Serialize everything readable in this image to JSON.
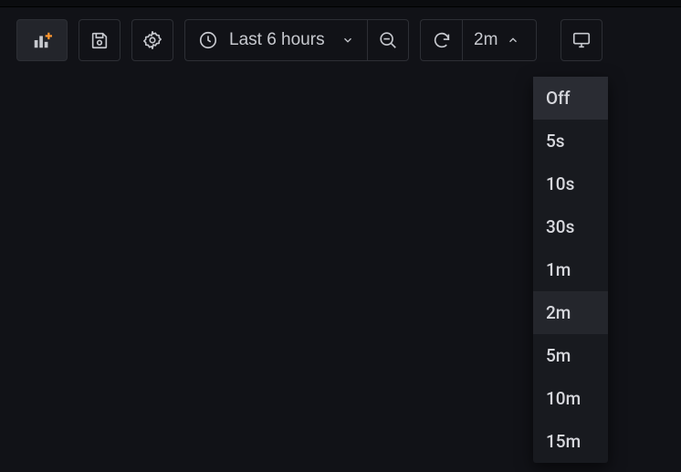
{
  "toolbar": {
    "time_range_label": "Last 6 hours",
    "refresh_interval_label": "2m"
  },
  "refresh_dropdown": {
    "visible": true,
    "highlighted_index": 0,
    "selected_index": 4,
    "options": [
      {
        "label": "Off"
      },
      {
        "label": "5s"
      },
      {
        "label": "10s"
      },
      {
        "label": "30s"
      },
      {
        "label": "1m"
      },
      {
        "label": "2m"
      },
      {
        "label": "5m"
      },
      {
        "label": "10m"
      },
      {
        "label": "15m"
      }
    ]
  }
}
